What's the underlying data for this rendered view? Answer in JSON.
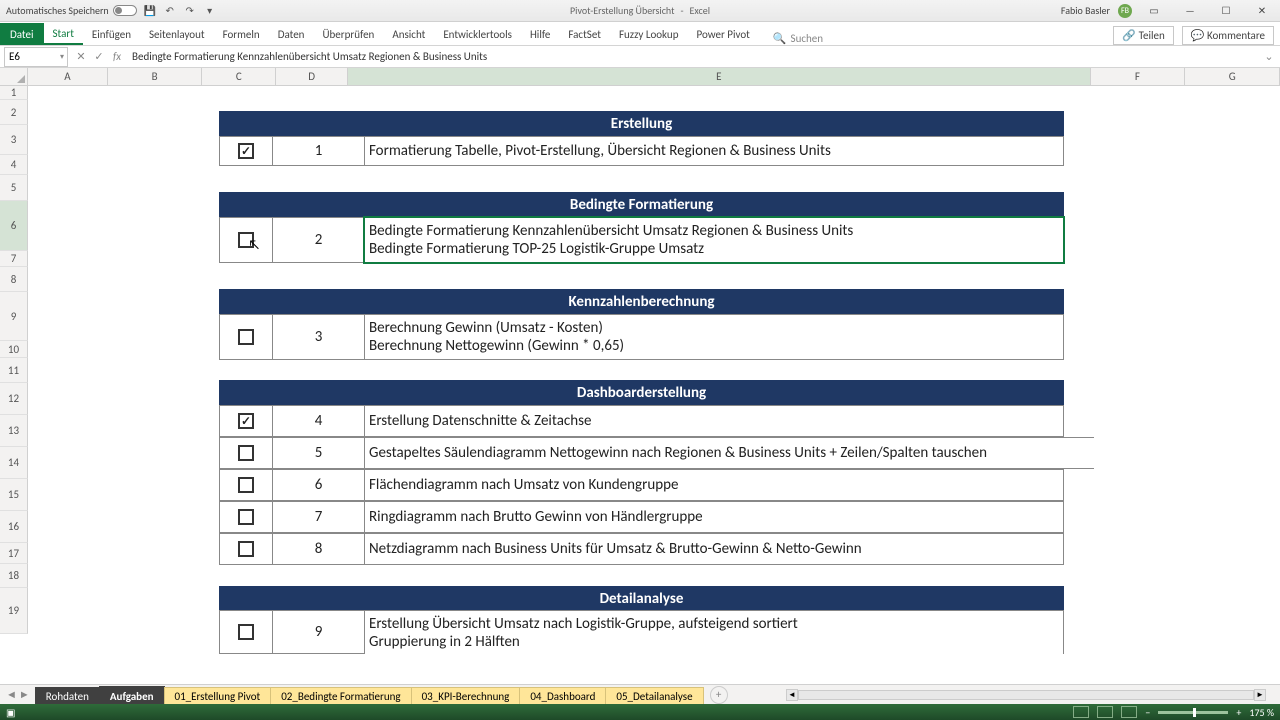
{
  "title": {
    "autosave": "Automatisches Speichern",
    "doc": "Pivot-Erstellung Übersicht",
    "app": "Excel",
    "user": "Fabio Basler",
    "initials": "FB"
  },
  "ribbon": {
    "file": "Datei",
    "tabs": [
      "Start",
      "Einfügen",
      "Seitenlayout",
      "Formeln",
      "Daten",
      "Überprüfen",
      "Ansicht",
      "Entwicklertools",
      "Hilfe",
      "FactSet",
      "Fuzzy Lookup",
      "Power Pivot"
    ],
    "search": "Suchen",
    "share": "Teilen",
    "comments": "Kommentare"
  },
  "namebox": "E6",
  "formula": "Bedingte Formatierung Kennzahlenübersicht Umsatz Regionen & Business Units",
  "columns": [
    "A",
    "B",
    "C",
    "D",
    "E",
    "F",
    "G"
  ],
  "rows": [
    "1",
    "2",
    "3",
    "4",
    "5",
    "6",
    "7",
    "8",
    "9",
    "10",
    "11",
    "12",
    "13",
    "14",
    "15",
    "16",
    "17",
    "18",
    "19"
  ],
  "sections": {
    "s1": {
      "title": "Erstellung",
      "rows": [
        {
          "checked": true,
          "num": "1",
          "text": "Formatierung Tabelle, Pivot-Erstellung, Übersicht Regionen & Business Units"
        }
      ]
    },
    "s2": {
      "title": "Bedingte Formatierung",
      "rows": [
        {
          "checked": false,
          "num": "2",
          "text1": "Bedingte Formatierung Kennzahlenübersicht Umsatz Regionen & Business Units",
          "text2": "Bedingte Formatierung TOP-25 Logistik-Gruppe Umsatz"
        }
      ]
    },
    "s3": {
      "title": "Kennzahlenberechnung",
      "rows": [
        {
          "checked": false,
          "num": "3",
          "text1": "Berechnung Gewinn (Umsatz - Kosten)",
          "text2": "Berechnung Nettogewinn (Gewinn * 0,65)"
        }
      ]
    },
    "s4": {
      "title": "Dashboarderstellung",
      "rows": [
        {
          "checked": true,
          "num": "4",
          "text": "Erstellung Datenschnitte & Zeitachse"
        },
        {
          "checked": false,
          "num": "5",
          "text": "Gestapeltes Säulendiagramm Nettogewinn nach Regionen & Business Units + Zeilen/Spalten tauschen"
        },
        {
          "checked": false,
          "num": "6",
          "text": "Flächendiagramm nach Umsatz von Kundengruppe"
        },
        {
          "checked": false,
          "num": "7",
          "text": "Ringdiagramm nach Brutto Gewinn von Händlergruppe"
        },
        {
          "checked": false,
          "num": "8",
          "text": "Netzdiagramm nach Business Units für Umsatz & Brutto-Gewinn & Netto-Gewinn"
        }
      ]
    },
    "s5": {
      "title": "Detailanalyse",
      "rows": [
        {
          "checked": false,
          "num": "9",
          "text1": "Erstellung Übersicht Umsatz nach Logistik-Gruppe, aufsteigend sortiert",
          "text2": "Gruppierung in 2 Hälften"
        }
      ]
    }
  },
  "sheets": {
    "nav": [
      "◄",
      "►"
    ],
    "dark": [
      "Rohdaten",
      "Aufgaben"
    ],
    "yellow": [
      "01_Erstellung Pivot",
      "02_Bedingte Formatierung",
      "03_KPI-Berechnung",
      "04_Dashboard",
      "05_Detailanalyse"
    ],
    "add": "+"
  },
  "status": {
    "ready": "",
    "zoom": "175 %"
  }
}
